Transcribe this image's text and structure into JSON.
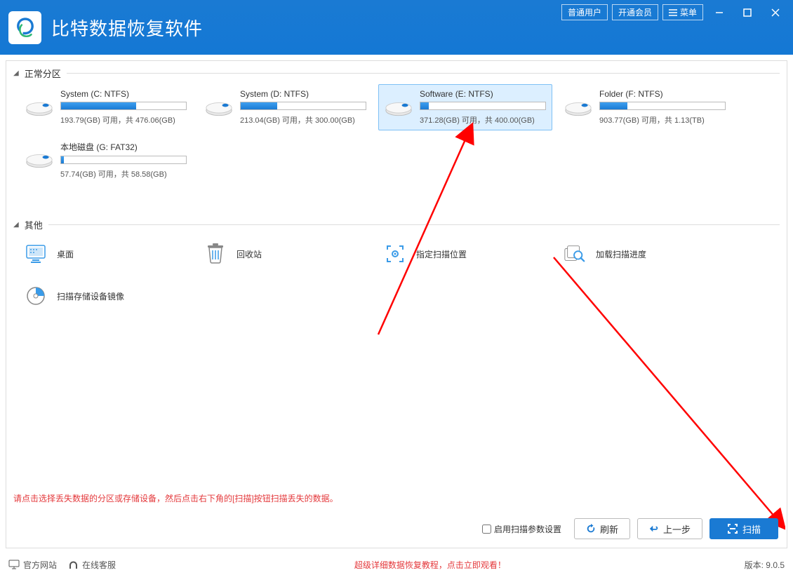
{
  "header": {
    "app_title": "比特数据恢复软件",
    "btn_user": "普通用户",
    "btn_vip": "开通会员",
    "btn_menu": "菜单"
  },
  "sections": {
    "normal": "正常分区",
    "other": "其他"
  },
  "partitions": [
    {
      "name": "System (C: NTFS)",
      "usage": "193.79(GB) 可用，共 476.06(GB)",
      "used_pct": 60
    },
    {
      "name": "System (D: NTFS)",
      "usage": "213.04(GB) 可用，共 300.00(GB)",
      "used_pct": 29
    },
    {
      "name": "Software (E: NTFS)",
      "usage": "371.28(GB) 可用，共 400.00(GB)",
      "used_pct": 7,
      "selected": true
    },
    {
      "name": "Folder (F: NTFS)",
      "usage": "903.77(GB) 可用，共 1.13(TB)",
      "used_pct": 22
    },
    {
      "name": "本地磁盘 (G: FAT32)",
      "usage": "57.74(GB) 可用，共 58.58(GB)",
      "used_pct": 2
    }
  ],
  "other_items": [
    {
      "label": "桌面",
      "icon": "desktop"
    },
    {
      "label": "回收站",
      "icon": "trash"
    },
    {
      "label": "指定扫描位置",
      "icon": "target"
    },
    {
      "label": "加载扫描进度",
      "icon": "search-doc"
    },
    {
      "label": "扫描存储设备镜像",
      "icon": "disc"
    }
  ],
  "footer": {
    "hint": "请点击选择丢失数据的分区或存储设备，然后点击右下角的[扫描]按钮扫描丢失的数据。",
    "checkbox_label": "启用扫描参数设置",
    "btn_refresh": "刷新",
    "btn_back": "上一步",
    "btn_scan": "扫描"
  },
  "statusbar": {
    "official_site": "官方网站",
    "online_support": "在线客服",
    "tutorial": "超级详细数据恢复教程，点击立即观看！",
    "version_label": "版本: 9.0.5"
  }
}
